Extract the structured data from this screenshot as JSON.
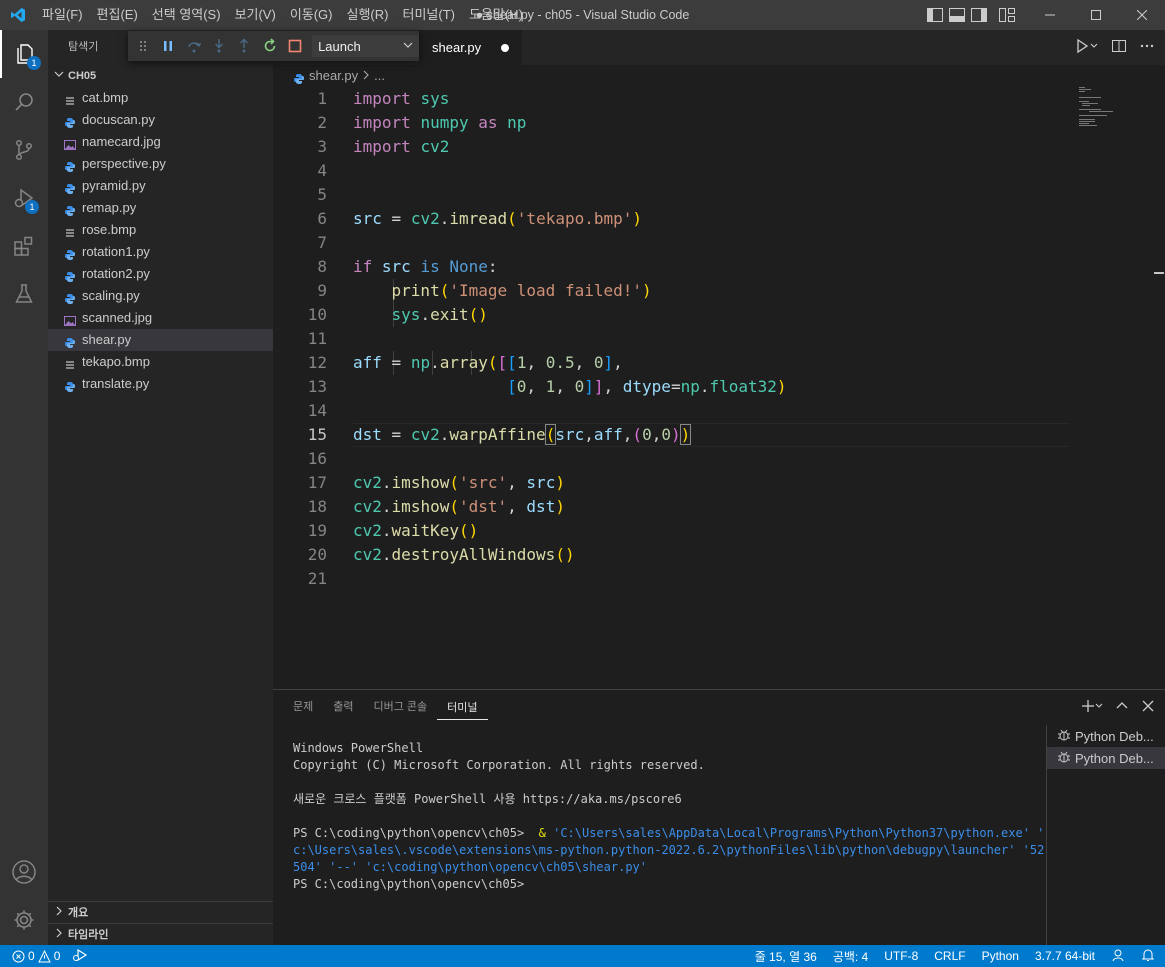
{
  "window": {
    "title": "● shear.py - ch05 - Visual Studio Code",
    "menu": [
      "파일(F)",
      "편집(E)",
      "선택 영역(S)",
      "보기(V)",
      "이동(G)",
      "실행(R)",
      "터미널(T)",
      "도움말(H)"
    ]
  },
  "activity": {
    "explorer_badge": "1",
    "debug_badge": "1"
  },
  "sidebar": {
    "title": "탐색기",
    "folder": "CH05",
    "files": [
      {
        "name": "cat.bmp",
        "type": "bmp"
      },
      {
        "name": "docuscan.py",
        "type": "py"
      },
      {
        "name": "namecard.jpg",
        "type": "img"
      },
      {
        "name": "perspective.py",
        "type": "py"
      },
      {
        "name": "pyramid.py",
        "type": "py"
      },
      {
        "name": "remap.py",
        "type": "py"
      },
      {
        "name": "rose.bmp",
        "type": "bmp"
      },
      {
        "name": "rotation1.py",
        "type": "py"
      },
      {
        "name": "rotation2.py",
        "type": "py"
      },
      {
        "name": "scaling.py",
        "type": "py"
      },
      {
        "name": "scanned.jpg",
        "type": "img"
      },
      {
        "name": "shear.py",
        "type": "py",
        "selected": true
      },
      {
        "name": "tekapo.bmp",
        "type": "bmp"
      },
      {
        "name": "translate.py",
        "type": "py"
      }
    ],
    "outline": "개요",
    "timeline": "타임라인"
  },
  "debug": {
    "config": "Launch"
  },
  "tab": {
    "name": "shear.py"
  },
  "breadcrumb": {
    "file": "shear.py",
    "rest": "..."
  },
  "editor": {
    "current_line": 15,
    "line_numbers": [
      "1",
      "2",
      "3",
      "4",
      "5",
      "6",
      "7",
      "8",
      "9",
      "10",
      "11",
      "12",
      "13",
      "14",
      "15",
      "16",
      "17",
      "18",
      "19",
      "20",
      "21"
    ]
  },
  "panel": {
    "tabs": [
      "문제",
      "출력",
      "디버그 콘솔",
      "터미널"
    ],
    "active_tab": "터미널",
    "terminal": {
      "line1": "Windows PowerShell",
      "line2": "Copyright (C) Microsoft Corporation. All rights reserved.",
      "line3": "새로운 크로스 플랫폼 PowerShell 사용 https://aka.ms/pscore6",
      "prompt": "PS C:\\coding\\python\\opencv\\ch05> ",
      "cmd_amp": " & ",
      "cmd_a": "'C:\\Users\\sales\\AppData\\Local\\Programs\\Python\\Python37\\python.exe' '",
      "cmd_b": "c:\\Users\\sales\\.vscode\\extensions\\ms-python.python-2022.6.2\\pythonFiles\\lib\\python\\debugpy\\launcher' '52",
      "cmd_c": "504' '--' 'c:\\coding\\python\\opencv\\ch05\\shear.py'",
      "prompt2": "PS C:\\coding\\python\\opencv\\ch05>"
    },
    "sessions": [
      "Python Deb...",
      "Python Deb..."
    ]
  },
  "status": {
    "errors": "0",
    "warnings": "0",
    "position": "줄 15, 열 36",
    "spaces": "공백: 4",
    "encoding": "UTF-8",
    "eol": "CRLF",
    "language": "Python",
    "interpreter": "3.7.7 64-bit"
  }
}
